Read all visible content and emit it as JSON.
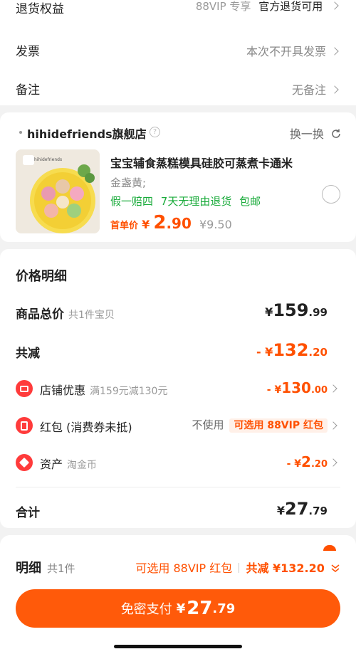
{
  "top": {
    "refund_label": "退货权益",
    "refund_tag": "88VIP 专享",
    "refund_value": "官方退货可用",
    "invoice_label": "发票",
    "invoice_value": "本次不开具发票",
    "note_label": "备注",
    "note_value": "无备注"
  },
  "shop": {
    "name": "hihidefriends旗舰店",
    "swap_label": "换一换",
    "product_title": "宝宝辅食蒸糕模具硅胶可蒸煮卡通米",
    "spec": "金盏黄;",
    "guarantees": [
      "假一赔四",
      "7天无理由退货",
      "包邮"
    ],
    "first_price_label": "首单价",
    "currency": "¥",
    "price_int": "2",
    "price_dec": ".90",
    "original_price": "¥9.50",
    "thumb_brand": "hihidefriends"
  },
  "breakdown": {
    "title": "价格明细",
    "total_label": "商品总价",
    "total_sub": "共1件宝贝",
    "total_currency": "¥",
    "total_int": "159",
    "total_dec": ".99",
    "reduce_label": "共减",
    "reduce_prefix": "- ¥",
    "reduce_int": "132",
    "reduce_dec": ".20",
    "store_label": "店铺优惠",
    "store_sub": "满159元减130元",
    "store_prefix": "- ¥",
    "store_int": "130",
    "store_dec": ".00",
    "redpacket_label": "红包 (消费券未抵)",
    "redpacket_status": "不使用",
    "redpacket_tag": "可选用 88VIP 红包",
    "asset_label": "资产",
    "asset_sub": "淘金币",
    "asset_prefix": "- ¥",
    "asset_int": "2",
    "asset_dec": ".20",
    "sum_label": "合计",
    "sum_currency": "¥",
    "sum_int": "27",
    "sum_dec": ".79"
  },
  "bottom": {
    "detail_label": "明细",
    "detail_sub": "共1件",
    "vip_hint": "可选用 88VIP 红包",
    "reduce_text": "共减 ¥132.20",
    "pay_label": "免密支付",
    "pay_currency": "¥",
    "pay_int": "27",
    "pay_dec": ".79"
  },
  "colors": {
    "accent": "#ff5000",
    "green": "#1aab3b",
    "pay_button": "#ff5a0a"
  }
}
